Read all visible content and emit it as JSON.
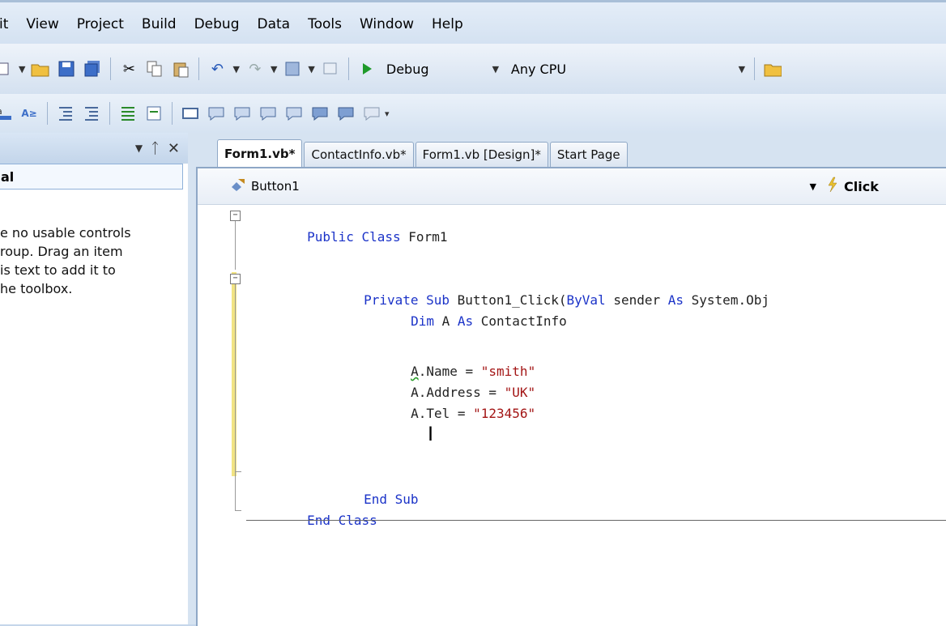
{
  "menu": [
    "it",
    "View",
    "Project",
    "Build",
    "Debug",
    "Data",
    "Tools",
    "Window",
    "Help"
  ],
  "toolbar": {
    "config_combo": "Debug",
    "platform_combo": "Any CPU"
  },
  "toolbox": {
    "group_label": "al",
    "empty_message_lines": [
      "e no usable controls",
      "roup. Drag an item",
      "is text to add it to",
      "he toolbox."
    ]
  },
  "tabs": [
    "Form1.vb*",
    "ContactInfo.vb*",
    "Form1.vb [Design]*",
    "Start Page"
  ],
  "navbar": {
    "class_combo": "Button1",
    "method_combo": "Click"
  },
  "code": {
    "line1": "Public Class Form1",
    "line2_kw1": "Private Sub ",
    "line2_name": "Button1_Click(",
    "line2_kw2": "ByVal",
    "line2_mid": " sender ",
    "line2_kw3": "As",
    "line2_tail": " System.Obj",
    "line3_kw1": "Dim",
    "line3_mid": " A ",
    "line3_kw2": "As",
    "line3_tail": " ContactInfo",
    "line4_a": "A",
    "line4_rest": ".Name = ",
    "line4_str": "\"smith\"",
    "line5_rest": "A.Address = ",
    "line5_str": "\"UK\"",
    "line6_rest": "A.Tel = ",
    "line6_str": "\"123456\"",
    "line7": "End Sub",
    "line8": "End Class"
  },
  "icons": [
    "open-folder-icon",
    "save-icon",
    "save-all-icon",
    "cut-icon",
    "copy-icon",
    "paste-icon",
    "undo-icon",
    "redo-icon",
    "start-icon"
  ]
}
